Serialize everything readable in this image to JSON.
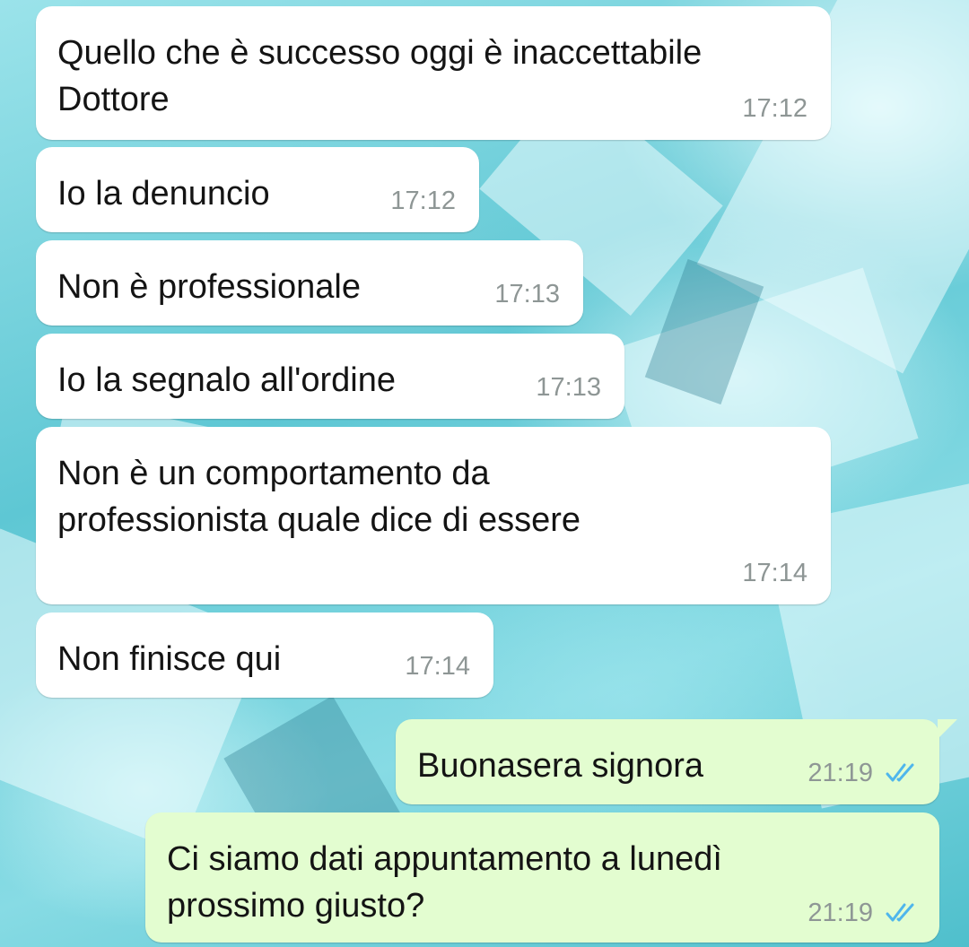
{
  "messages": [
    {
      "direction": "incoming",
      "text_lines": [
        "Quello che è successo oggi è inaccettabile",
        "Dottore"
      ],
      "time": "17:12"
    },
    {
      "direction": "incoming",
      "text_lines": [
        "Io la denuncio"
      ],
      "time": "17:12"
    },
    {
      "direction": "incoming",
      "text_lines": [
        "Non è professionale"
      ],
      "time": "17:13"
    },
    {
      "direction": "incoming",
      "text_lines": [
        "Io la segnalo all'ordine"
      ],
      "time": "17:13"
    },
    {
      "direction": "incoming",
      "text_lines": [
        "Non è un comportamento da",
        "professionista quale dice di essere"
      ],
      "time": "17:14"
    },
    {
      "direction": "incoming",
      "text_lines": [
        "Non finisce qui"
      ],
      "time": "17:14"
    },
    {
      "direction": "outgoing",
      "text_lines": [
        "Buonasera signora"
      ],
      "time": "21:19",
      "status_icon": "double-check-read-icon"
    },
    {
      "direction": "outgoing",
      "text_lines": [
        "Ci siamo dati appuntamento a lunedì",
        "prossimo giusto?"
      ],
      "time": "21:19",
      "status_icon": "double-check-read-icon"
    }
  ],
  "colors": {
    "incoming_bubble": "#ffffff",
    "outgoing_bubble": "#e3fdd0",
    "timestamp": "#8e9695",
    "read_check": "#4fb6ec",
    "wallpaper": "#6fd0dc"
  }
}
